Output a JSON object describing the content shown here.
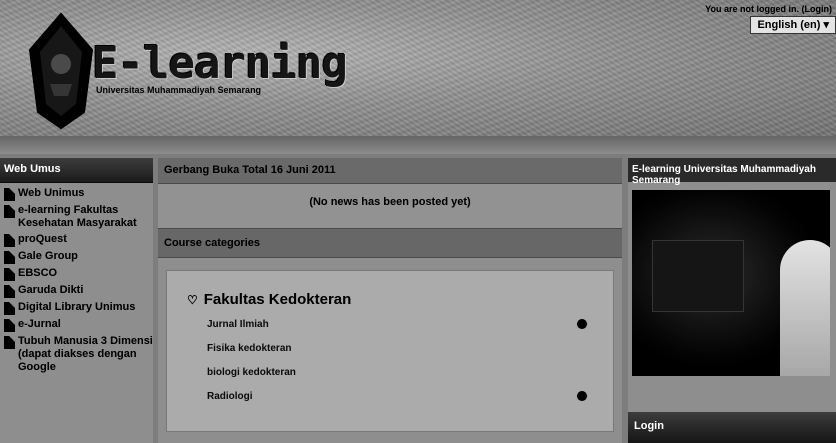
{
  "header": {
    "brand_title": "E-learning",
    "brand_subtitle": "Universitas Muhammadiyah Semarang",
    "login_note": "You are not logged in. (Login)",
    "language": "English (en)"
  },
  "sidebar": {
    "heading": "Web Umus",
    "items": [
      {
        "label": "Web Unimus"
      },
      {
        "label": "e-learning Fakultas Kesehatan Masyarakat"
      },
      {
        "label": "proQuest"
      },
      {
        "label": "Gale Group"
      },
      {
        "label": "EBSCO"
      },
      {
        "label": "Garuda Dikti"
      },
      {
        "label": "Digital Library Unimus"
      },
      {
        "label": "e-Jurnal"
      },
      {
        "label": "Tubuh Manusia 3 Dimensi (dapat diakses dengan Google"
      }
    ]
  },
  "main": {
    "news_heading": "Gerbang Buka Total 16 Juni 2011",
    "news_empty": "(No news has been posted yet)",
    "categories_heading": "Course categories",
    "category": {
      "name": "Fakultas Kedokteran",
      "courses": [
        "Jurnal Ilmiah",
        "Fisika kedokteran",
        "biologi kedokteran",
        "Radiologi"
      ]
    }
  },
  "right": {
    "heading": "E-learning Universitas Muhammadiyah Semarang",
    "login_heading": "Login"
  }
}
